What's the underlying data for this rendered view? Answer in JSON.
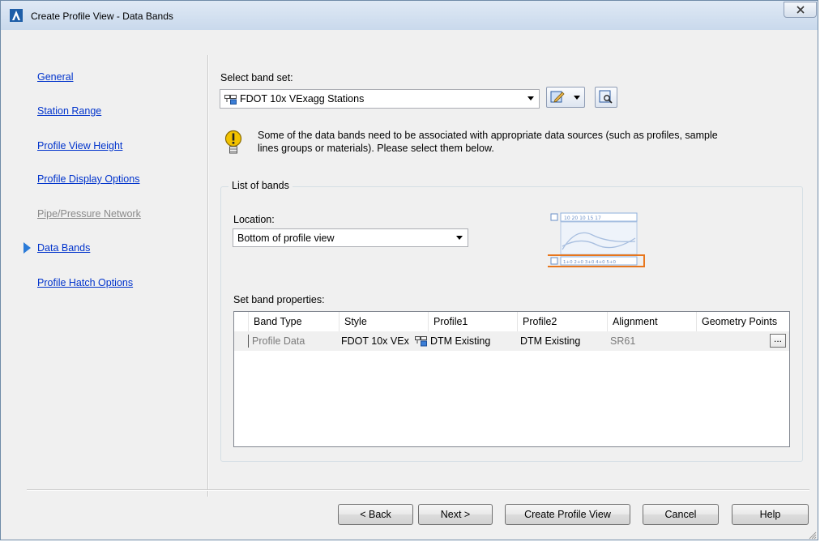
{
  "window": {
    "title": "Create Profile View - Data Bands",
    "close_glyph": "X"
  },
  "nav": {
    "items": [
      {
        "label": "General",
        "enabled": true
      },
      {
        "label": "Station Range",
        "enabled": true
      },
      {
        "label": "Profile View Height",
        "enabled": true
      },
      {
        "label": "Profile Display Options",
        "enabled": true
      },
      {
        "label": "Pipe/Pressure Network",
        "enabled": false
      },
      {
        "label": "Data Bands",
        "enabled": true,
        "current": true
      },
      {
        "label": "Profile Hatch Options",
        "enabled": true
      }
    ]
  },
  "band_set": {
    "label": "Select band set:",
    "value": "FDOT 10x VExagg Stations"
  },
  "warning": {
    "text_line1": "Some of the data bands need to be associated with appropriate data sources (such as profiles, sample",
    "text_line2": "lines groups or materials). Please select them below."
  },
  "list_of_bands": {
    "title": "List of bands",
    "location_label": "Location:",
    "location_value": "Bottom of profile view",
    "preview_top_ticks": "10   20   10   15   17",
    "preview_bottom_ticks": "1+0 2+0 3+0 4+0 5+0",
    "properties_label": "Set band properties:"
  },
  "grid": {
    "columns": [
      "Band Type",
      "Style",
      "Profile1",
      "Profile2",
      "Alignment",
      "Geometry Points"
    ],
    "rows": [
      {
        "band_type": "Profile Data",
        "style": "FDOT 10x VEx",
        "profile1": "DTM Existing",
        "profile2": "DTM Existing",
        "alignment": "SR61",
        "geometry_points": "..."
      }
    ]
  },
  "buttons": {
    "back": "< Back",
    "next": "Next >",
    "create": "Create Profile View",
    "cancel": "Cancel",
    "help": "Help"
  },
  "colors": {
    "accent": "#2b7bd8",
    "link": "#0033cc",
    "highlight": "#e8761c",
    "warning": "#f2c200"
  }
}
